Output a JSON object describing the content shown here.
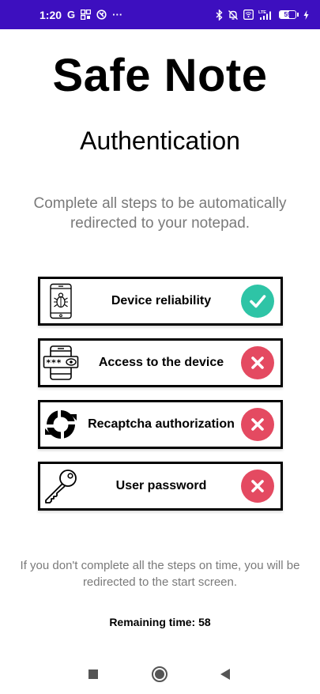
{
  "status_bar": {
    "time": "1:20",
    "left_icons": [
      "google-icon",
      "grid-icon",
      "vpn-icon",
      "more-dots-icon"
    ],
    "google_glyph": "G",
    "more_glyph": "···",
    "network_label": "LTE",
    "battery_level": "59",
    "battery_percent": 59,
    "background_color": "#3d0fbf"
  },
  "app": {
    "title": "Safe Note",
    "subtitle": "Authentication",
    "intro": "Complete all steps to be automatically redirected to your notepad."
  },
  "steps": [
    {
      "label": "Device reliability",
      "status": "completed",
      "icon": "phone-bug-icon",
      "status_icon": "checkmark-icon"
    },
    {
      "label": "Access to the device",
      "status": "failed",
      "icon": "phone-password-icon",
      "status_icon": "close-icon"
    },
    {
      "label": "Recaptcha authorization",
      "status": "failed",
      "icon": "recaptcha-icon",
      "status_icon": "close-icon"
    },
    {
      "label": "User password",
      "status": "failed",
      "icon": "key-icon",
      "status_icon": "close-icon"
    }
  ],
  "colors": {
    "success": "#2ec4a6",
    "failure": "#e44a61",
    "muted_text": "#7a7a7a"
  },
  "footer": {
    "warning": "If you don't complete all the steps on time, you will be redirected to the start screen.",
    "remaining_time_label": "Remaining time: 58"
  },
  "nav_bar": {
    "buttons": [
      "recents-square-icon",
      "home-circle-icon",
      "back-triangle-icon"
    ]
  }
}
